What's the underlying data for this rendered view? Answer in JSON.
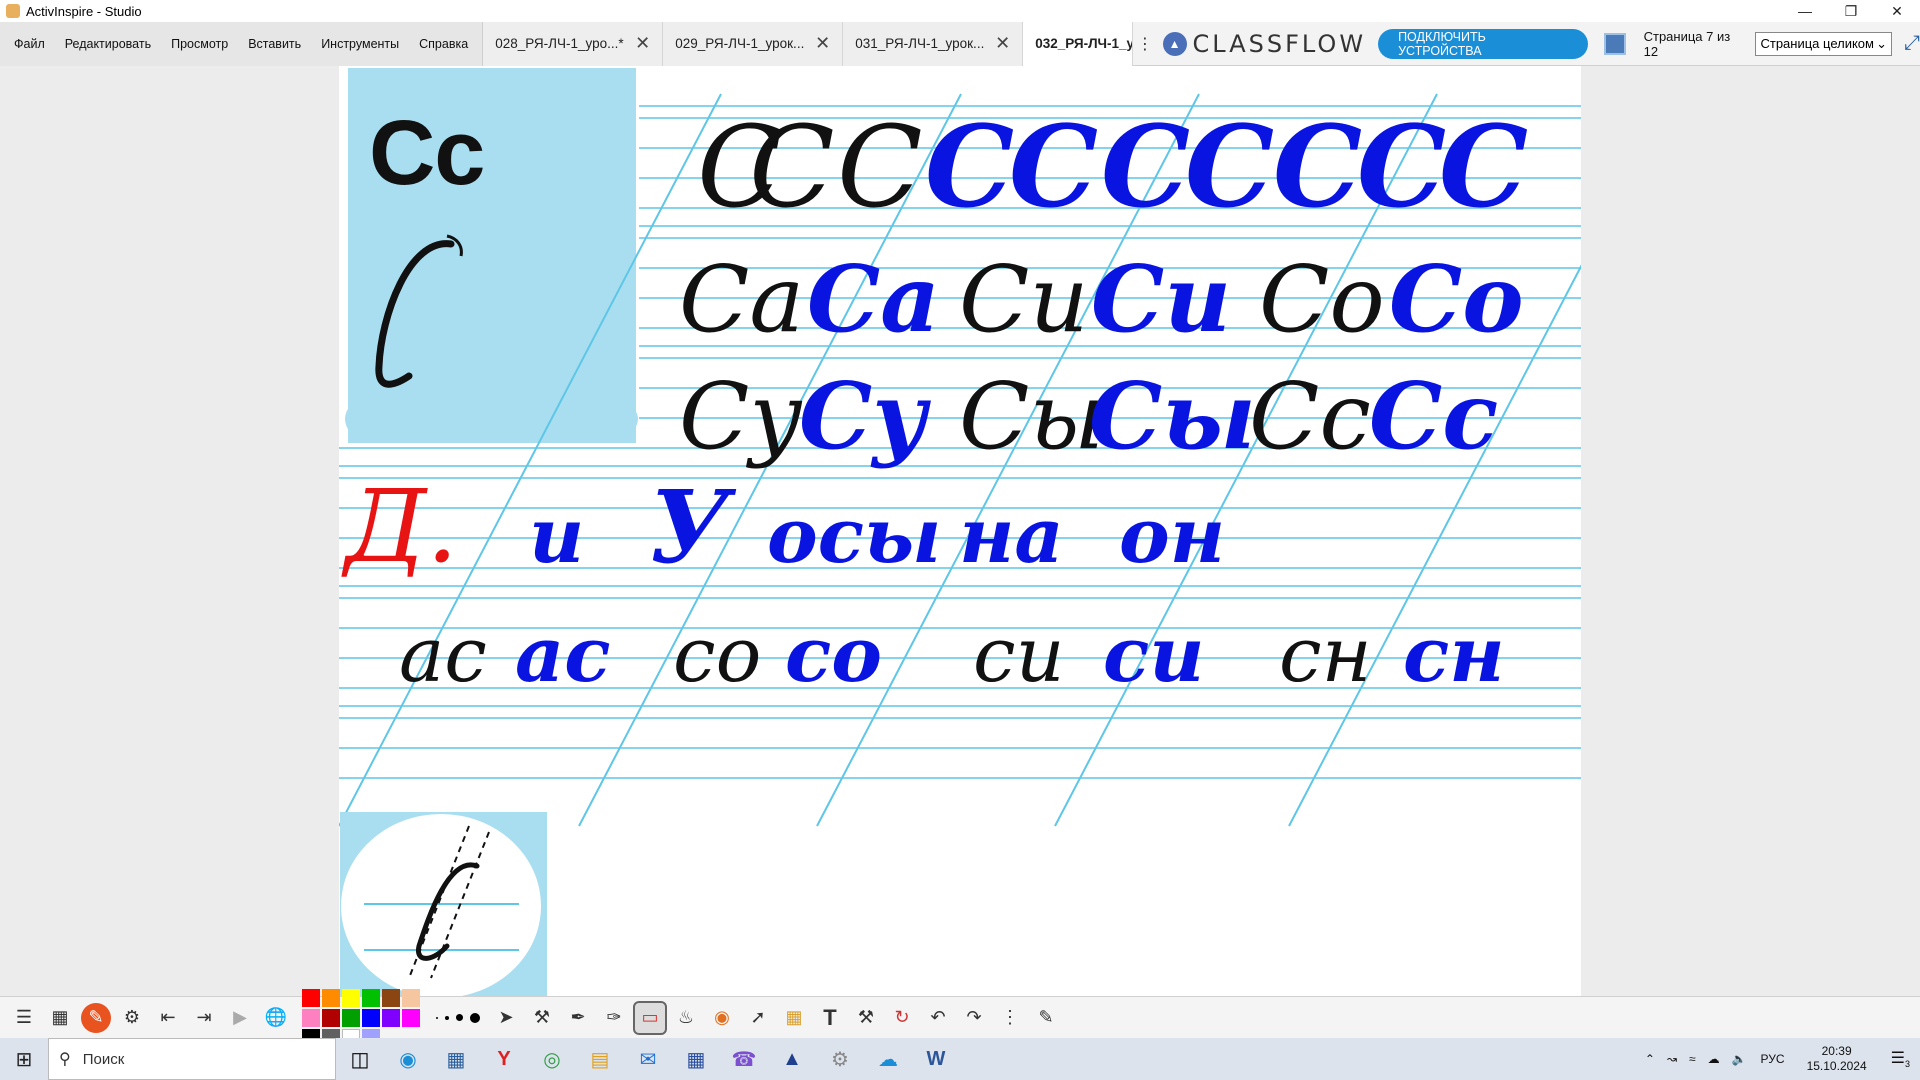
{
  "window": {
    "title": "ActivInspire - Studio"
  },
  "menu": [
    "Файл",
    "Редактировать",
    "Просмотр",
    "Вставить",
    "Инструменты",
    "Справка"
  ],
  "tabs": [
    {
      "label": "028_РЯ-ЛЧ-1_уро...*"
    },
    {
      "label": "029_РЯ-ЛЧ-1_урок..."
    },
    {
      "label": "031_РЯ-ЛЧ-1_урок..."
    },
    {
      "label": "032_РЯ-ЛЧ-1_у"
    }
  ],
  "classflow": {
    "logo": "CLASSFLOW",
    "connect": "ПОДКЛЮЧИТЬ УСТРОЙСТВА"
  },
  "page": {
    "counter": "Страница 7 из 12",
    "zoom": "Страница целиком"
  },
  "worksheet": {
    "big_letter": "Сс",
    "row1": [
      "С",
      "С",
      "С",
      "С",
      "С",
      "С",
      "С",
      "С",
      "С",
      "С"
    ],
    "row2_black": [
      "Са",
      "Си",
      "Со"
    ],
    "row2_blue": [
      "Са",
      "Си",
      "Со"
    ],
    "row3_black": [
      "Су",
      "Сы",
      "Сс"
    ],
    "row3_blue": [
      "Су",
      "Сы",
      "Сс"
    ],
    "red_label": "Д.",
    "dictation": [
      "и",
      "У",
      "осы",
      "на",
      "он"
    ],
    "row5_black": [
      "ас",
      "со",
      "си",
      "сн"
    ],
    "row5_blue": [
      "ас",
      "со",
      "си",
      "сн"
    ],
    "colors": {
      "line": "#5ec6e6",
      "blue_ink": "#0a14e0",
      "red_ink": "#e81414",
      "panel": "#a9def0"
    }
  },
  "toolbar": {
    "palette": [
      "#ff0000",
      "#ff8c00",
      "#ffff00",
      "#00c000",
      "#8b4513",
      "#f5c6a0",
      "#ff80c0",
      "#b00000",
      "#00a000",
      "#0000ff",
      "#8000ff",
      "#ff00ff",
      "#000000",
      "#606060",
      "#ffffff",
      "#a0a0ff"
    ]
  },
  "taskbar": {
    "search_placeholder": "Поиск",
    "lang": "РУС",
    "time": "20:39",
    "date": "15.10.2024",
    "notif": "3"
  }
}
